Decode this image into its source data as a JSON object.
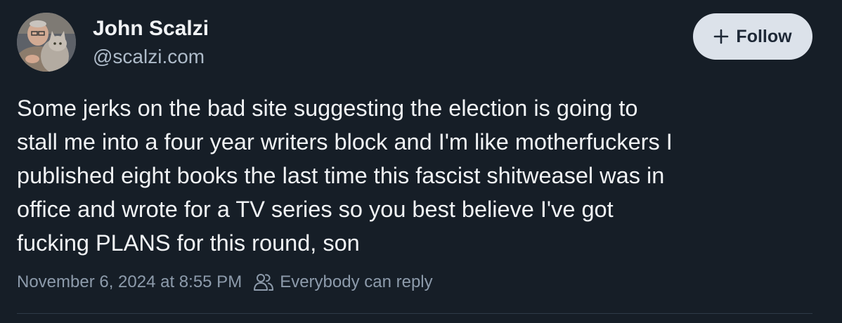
{
  "author": {
    "display_name": "John Scalzi",
    "handle": "@scalzi.com",
    "avatar_icon": "user-avatar-photo"
  },
  "follow_button": {
    "label": "Follow",
    "icon": "plus-icon"
  },
  "post": {
    "text": "Some jerks on the bad site suggesting the election is going to\nstall me into a four year writers block and I'm like motherfuckers I\npublished eight books the last time this fascist shitweasel was in\noffice and wrote for a TV series so you best believe I've got\nfucking PLANS for this round, son",
    "timestamp": "November 6, 2024 at 8:55 PM",
    "reply_setting": "Everybody can reply",
    "reply_icon": "people-icon"
  },
  "colors": {
    "background": "#161e27",
    "text": "#f1f3f5",
    "muted": "#8d9bab",
    "button_bg": "#dce2ea",
    "button_text": "#1e2836"
  }
}
